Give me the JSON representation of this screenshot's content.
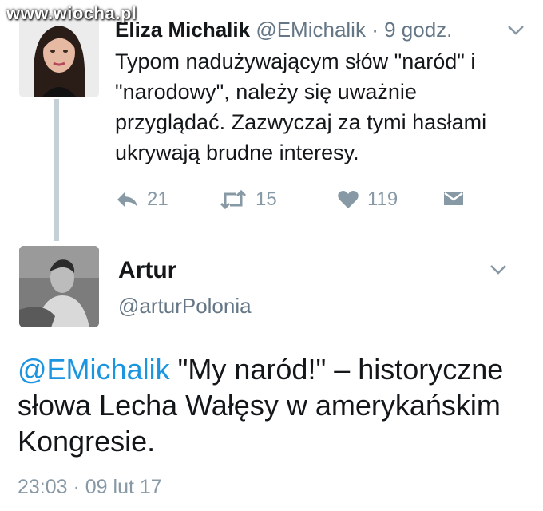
{
  "watermark": "www.wiocha.pl",
  "tweet1": {
    "name": "Eliza Michalik",
    "handle": "@EMichalik",
    "separator": "·",
    "time": "9 godz.",
    "text": "Typom nadużywającym słów \"naród\" i \"narodowy\", należy się uważnie przyglądać. Zazwyczaj za tymi hasłami ukrywają brudne interesy.",
    "reply_count": "21",
    "retweet_count": "15",
    "like_count": "119"
  },
  "tweet2": {
    "name": "Artur",
    "handle": "@arturPolonia",
    "mention": "@EMichalik",
    "text": " \"My naród!\" – historyczne słowa Lecha Wałęsy w amerykańskim Kongresie.",
    "timestamp": "23:03 · 09 lut 17"
  },
  "icons": {
    "menu": "chevron-down-icon",
    "reply": "reply-icon",
    "retweet": "retweet-icon",
    "like": "heart-icon",
    "dm": "envelope-icon"
  },
  "colors": {
    "link": "#1b95e0",
    "muted": "#657786",
    "icon": "#8899a6",
    "thread_line": "#c4cfd6"
  }
}
